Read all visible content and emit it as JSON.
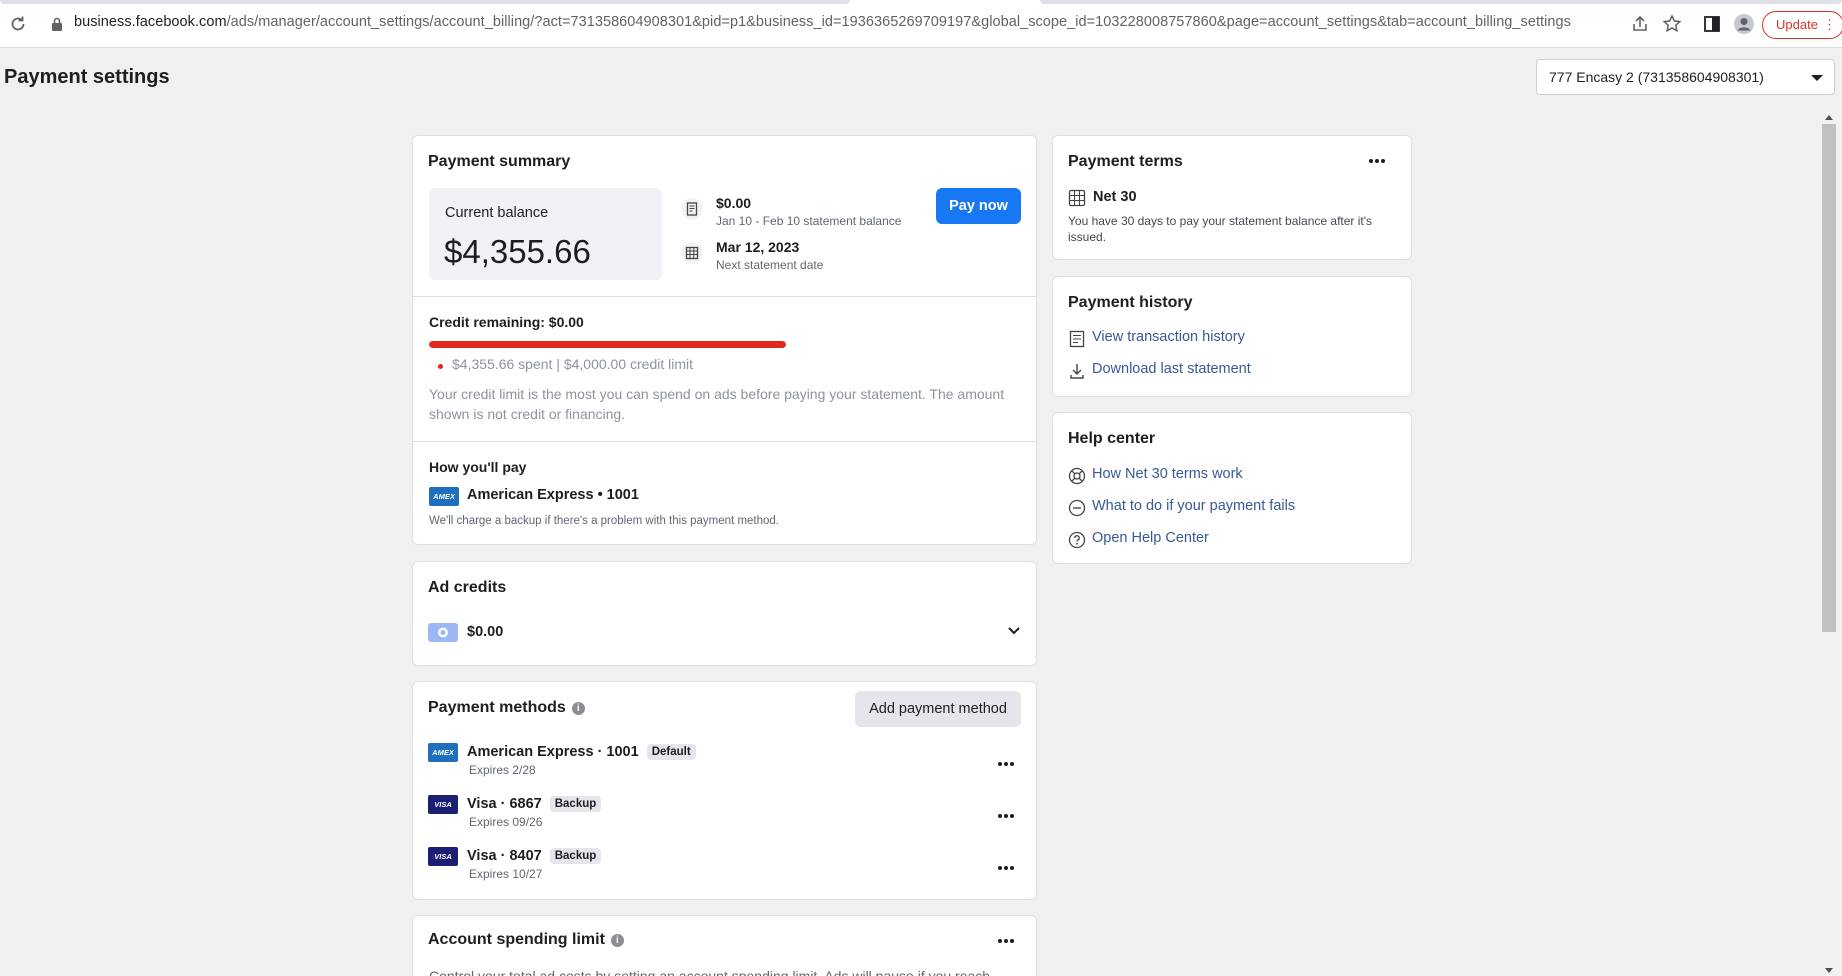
{
  "browser": {
    "url_host": "business.facebook.com",
    "url_path": "/ads/manager/account_settings/account_billing/?act=731358604908301&pid=p1&business_id=1936365269709197&global_scope_id=103228008757860&page=account_settings&tab=account_billing_settings",
    "update_label": "Update"
  },
  "header": {
    "title": "Payment settings",
    "account_selector": "777 Encasy 2 (731358604908301)"
  },
  "payment_summary": {
    "title": "Payment summary",
    "current_balance_label": "Current balance",
    "current_balance": "$4,355.66",
    "statement_balance": "$0.00",
    "statement_balance_sub": "Jan 10 - Feb 10 statement balance",
    "next_statement_date": "Mar 12, 2023",
    "next_statement_sub": "Next statement date",
    "pay_now_label": "Pay now",
    "credit_remaining": "Credit remaining: $0.00",
    "credit_progress_fraction": 1.0,
    "credit_bar_color": "#e1291b",
    "spent_line": "$4,355.66 spent | $4,000.00 credit limit",
    "credit_note": "Your credit limit is the most you can spend on ads before paying your statement. The amount shown is not credit or financing.",
    "how_pay_title": "How you'll pay",
    "how_pay_method": "American Express • 1001",
    "how_pay_note": "We'll charge a backup if there's a problem with this payment method."
  },
  "ad_credits": {
    "title": "Ad credits",
    "amount": "$0.00"
  },
  "payment_methods": {
    "title": "Payment methods",
    "add_label": "Add payment method",
    "items": [
      {
        "brand": "amex",
        "logo_text": "AMEX",
        "name": "American Express · 1001",
        "badge": "Default",
        "expires": "Expires 2/28"
      },
      {
        "brand": "visa",
        "logo_text": "VISA",
        "name": "Visa · 6867",
        "badge": "Backup",
        "expires": "Expires 09/26"
      },
      {
        "brand": "visa",
        "logo_text": "VISA",
        "name": "Visa · 8407",
        "badge": "Backup",
        "expires": "Expires 10/27"
      }
    ]
  },
  "spending_limit": {
    "title": "Account spending limit",
    "text": "Control your total ad costs by setting an account spending limit. Ads will pause if you reach"
  },
  "payment_terms": {
    "title": "Payment terms",
    "term": "Net 30",
    "description": "You have 30 days to pay your statement balance after it's issued."
  },
  "payment_history": {
    "title": "Payment history",
    "view_transactions": "View transaction history",
    "download_statement": "Download last statement"
  },
  "help_center": {
    "title": "Help center",
    "how_net30": "How Net 30 terms work",
    "payment_fails": "What to do if your payment fails",
    "open_help": "Open Help Center"
  },
  "colors": {
    "accent": "#1877f2",
    "link": "#385898",
    "page_bg": "#f0f0f0"
  }
}
